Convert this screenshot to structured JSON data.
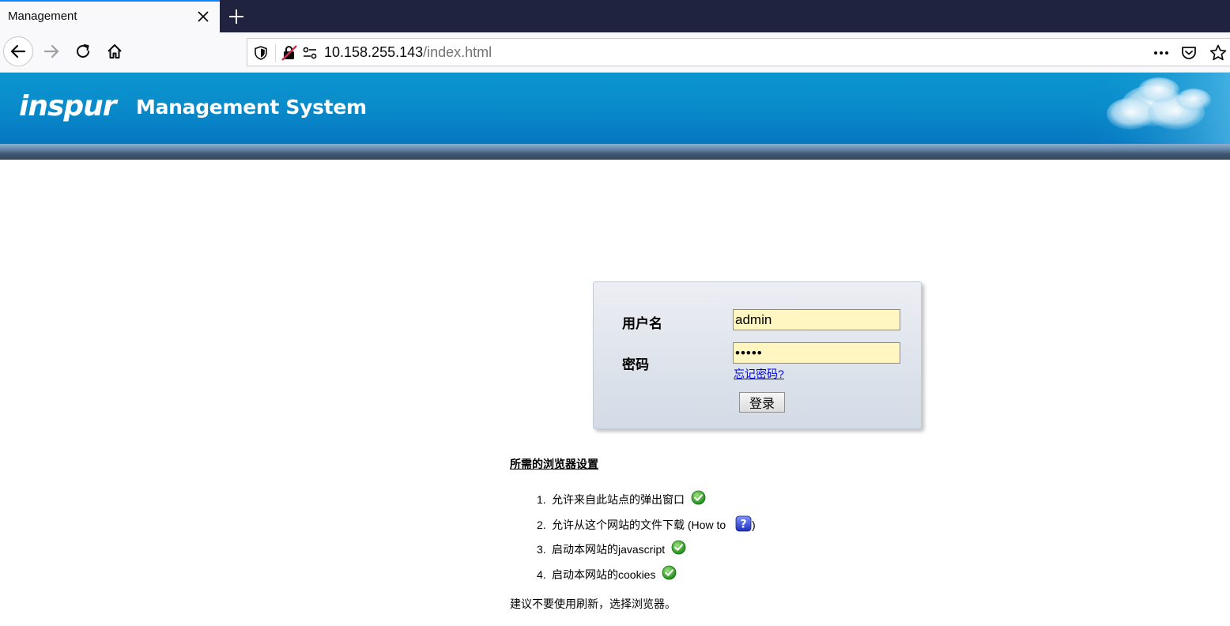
{
  "browser": {
    "tab_title": "Management",
    "url_host": "10.158.255.143",
    "url_path": "/index.html"
  },
  "header": {
    "logo_text": "inspur",
    "system_title": "Management System",
    "brand_color": "#0a8ccb"
  },
  "login": {
    "username_label": "用户名",
    "username_value": "admin",
    "password_label": "密码",
    "password_value": "admin",
    "forgot_link": "忘记密码?",
    "submit_label": "登录"
  },
  "settings": {
    "title": "所需的浏览器设置",
    "items": [
      {
        "num": "1.",
        "text": "允许来自此站点的弹出窗口",
        "icon": "check-icon"
      },
      {
        "num": "2.",
        "text": "允许从这个网站的文件下载 (How to ",
        "icon": "help-icon",
        "suffix": ")"
      },
      {
        "num": "3.",
        "text": "启动本网站的javascript",
        "icon": "check-icon"
      },
      {
        "num": "4.",
        "text": "启动本网站的cookies",
        "icon": "check-icon"
      }
    ],
    "footer_note": "建议不要使用刷新，选择浏览器。"
  }
}
